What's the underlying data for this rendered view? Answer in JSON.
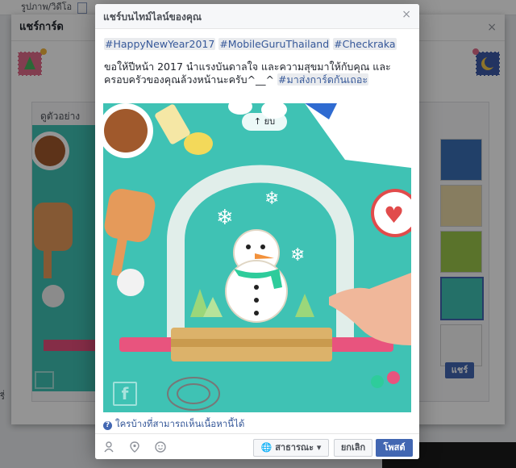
{
  "background": {
    "tabs": [
      "รูปภาพ/วิดีโอ"
    ],
    "modal_title": "แชร์การ์ด",
    "close_label": "×",
    "preview_label": "ดูตัวอย่าง",
    "share_button": "แชร์",
    "side_fragment": "รี่"
  },
  "dialog": {
    "title": "แชร์บนไทม์ไลน์ของคุณ",
    "close_label": "×",
    "hashtags": [
      "#HappyNewYear2017",
      "#MobileGuruThailand",
      "#Checkraka"
    ],
    "message_line1": "ขอให้ปีหน้า 2017 นำแรงบันดาลใจ และความสุขมาให้กับคุณ และ",
    "message_line2_plain": "ครอบครัวของคุณล้วงหน้านะครับ^__^ ",
    "message_line2_tag": "#มาส่งการ์ดกันเถอะ",
    "move_button": "↑ ยบ",
    "audience_note": "ใครบ้างที่สามารถเห็นเนื้อหานี้ได้",
    "privacy_button": "สาธารณะ ▾",
    "cancel_button": "ยกเลิก",
    "post_button": "โพสต์"
  },
  "icons": [
    "tag-friends-icon",
    "location-pin-icon",
    "feeling-emoji-icon",
    "globe-icon",
    "question-icon"
  ],
  "colors": {
    "photo_bg": "#3fc2b4",
    "facebook_blue": "#4267b2",
    "link_blue": "#365899"
  }
}
